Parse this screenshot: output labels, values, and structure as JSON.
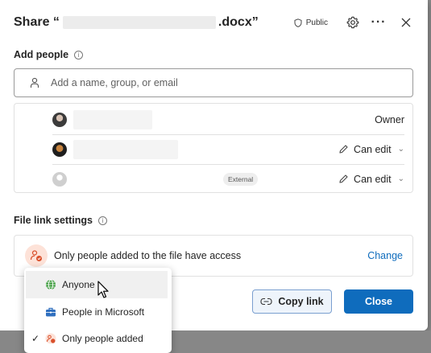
{
  "dialog": {
    "title_prefix": "Share “",
    "title_suffix": ".docx”",
    "public_label": "Public",
    "icons": {
      "public": "shield-icon",
      "settings": "gear-icon",
      "more": "more-options-icon",
      "close": "close-icon"
    }
  },
  "add_people": {
    "label": "Add people",
    "placeholder": "Add a name, group, or email"
  },
  "people": [
    {
      "role": "Owner",
      "editable": false,
      "badge": ""
    },
    {
      "role": "Can edit",
      "editable": true,
      "badge": ""
    },
    {
      "role": "Can edit",
      "editable": true,
      "badge": "External"
    }
  ],
  "file_link": {
    "label": "File link settings",
    "access_text": "Only people added to the file have access",
    "change_label": "Change"
  },
  "buttons": {
    "copy_link": "Copy link",
    "close": "Close"
  },
  "access_menu": {
    "items": [
      {
        "label": "Anyone",
        "icon": "globe-icon",
        "hovered": true,
        "checked": false
      },
      {
        "label": "People in Microsoft",
        "icon": "briefcase-icon",
        "hovered": false,
        "checked": false
      },
      {
        "label": "Only people added",
        "icon": "people-lock-icon",
        "hovered": false,
        "checked": true
      }
    ]
  },
  "colors": {
    "primary": "#0f6cbd",
    "link_icon_bg": "#fde2d8",
    "anyone_icon": "#3a9a3a",
    "org_icon": "#2f6fbf",
    "restricted_icon": "#d9502c"
  }
}
